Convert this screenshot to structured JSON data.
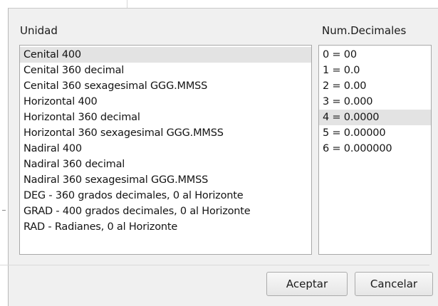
{
  "dialog": {
    "units_label": "Unidad",
    "decimals_label": "Num.Decimales",
    "units": [
      "Cenital 400",
      "Cenital 360 decimal",
      "Cenital 360 sexagesimal GGG.MMSS",
      "Horizontal 400",
      "Horizontal 360 decimal",
      "Horizontal 360 sexagesimal GGG.MMSS",
      "Nadiral 400",
      "Nadiral 360 decimal",
      "Nadiral 360 sexagesimal GGG.MMSS",
      "DEG - 360 grados decimales, 0 al Horizonte",
      "GRAD - 400 grados decimales, 0 al Horizonte",
      "RAD - Radianes, 0 al Horizonte"
    ],
    "decimals": [
      "0 = 00",
      "1 = 0.0",
      "2 = 0.00",
      "3 = 0.000",
      "4 = 0.0000",
      "5 = 0.00000",
      "6 = 0.000000"
    ],
    "selected_unit": "Cenital 400",
    "selected_decimal": "4 = 0.0000",
    "accept_label": "Aceptar",
    "cancel_label": "Cancelar"
  }
}
